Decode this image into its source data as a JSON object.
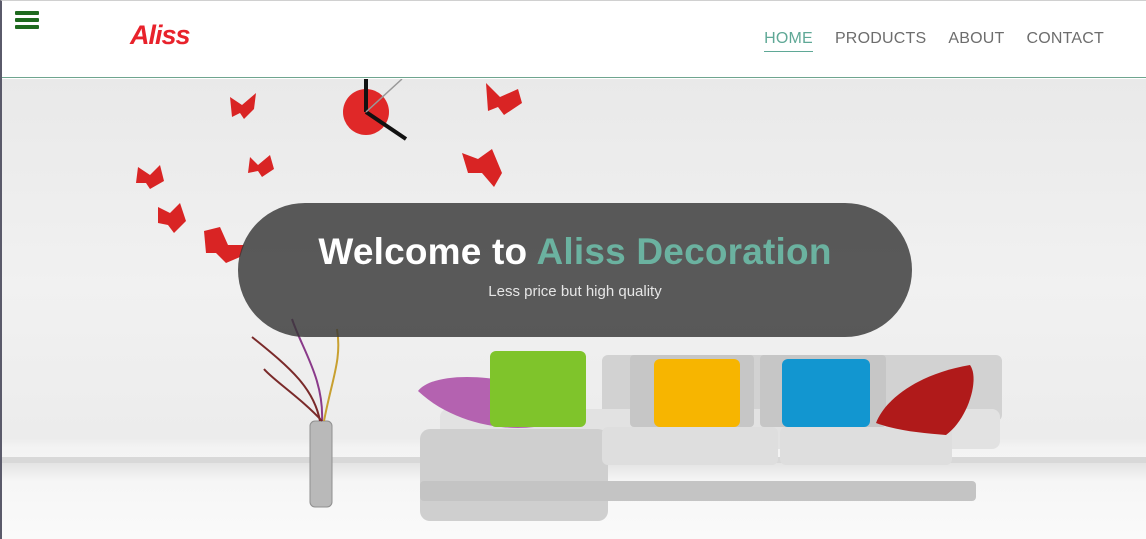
{
  "header": {
    "logo_text": "Aliss",
    "menu_icon": "hamburger-menu-icon",
    "nav": [
      {
        "label": "HOME",
        "active": true
      },
      {
        "label": "PRODUCTS",
        "active": false
      },
      {
        "label": "ABOUT",
        "active": false
      },
      {
        "label": "CONTACT",
        "active": false
      }
    ]
  },
  "hero": {
    "title_prefix": "Welcome to",
    "title_brand": "Aliss Decoration",
    "subtitle": "Less price but high quality"
  },
  "colors": {
    "brand_red": "#e8222b",
    "accent_teal": "#5fa896",
    "menu_icon_green": "#1f6a1f"
  }
}
